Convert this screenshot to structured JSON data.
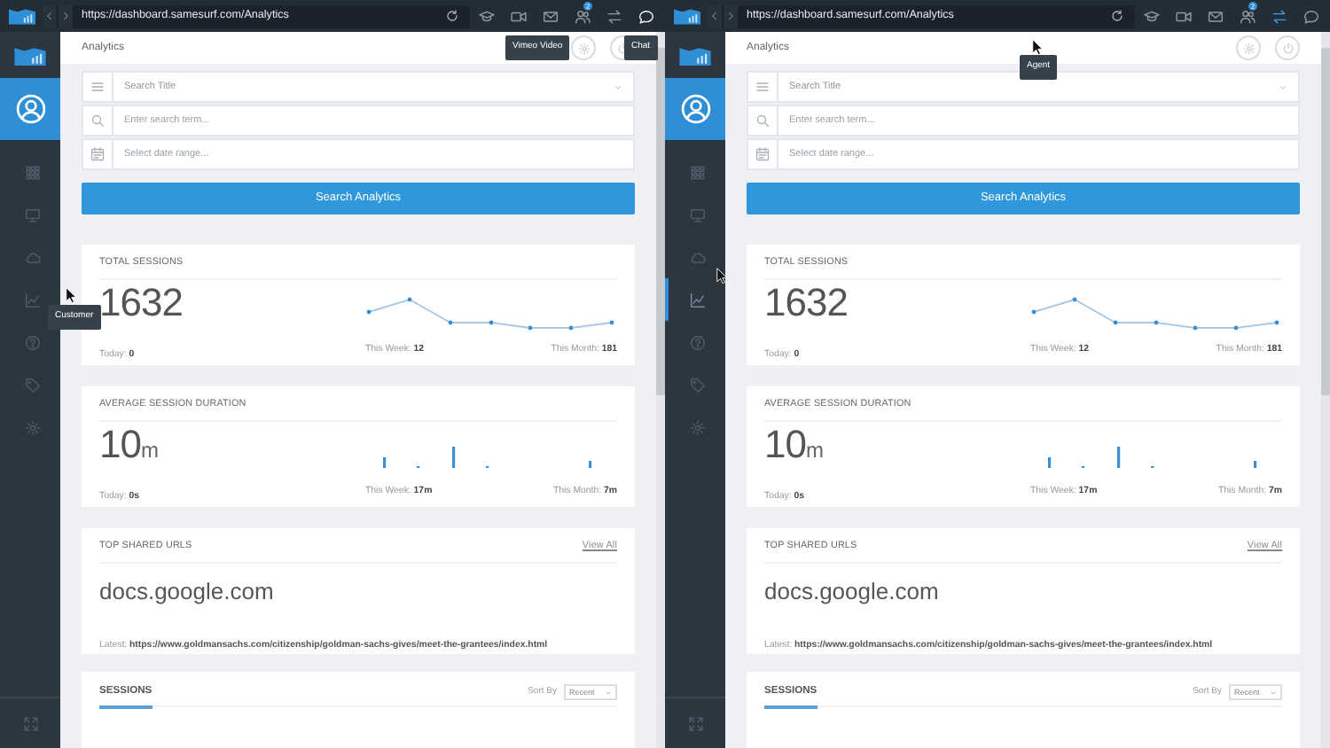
{
  "panes": [
    {
      "address": "https://dashboard.samesurf.com/Analytics",
      "toolbar": [
        {
          "kind": "cap",
          "active": false
        },
        {
          "kind": "video",
          "active": false
        },
        {
          "kind": "mail",
          "active": false
        },
        {
          "kind": "users",
          "active": false,
          "badge": "2"
        },
        {
          "kind": "transfer",
          "active": false
        },
        {
          "kind": "chat",
          "active": true
        }
      ],
      "sidebar": [
        {
          "kind": "grid",
          "selected": false
        },
        {
          "kind": "monitor",
          "selected": false
        },
        {
          "kind": "cloud",
          "selected": false
        },
        {
          "kind": "chart",
          "selected": false
        },
        {
          "kind": "help",
          "selected": false
        },
        {
          "kind": "tag",
          "selected": false
        },
        {
          "kind": "gear",
          "selected": false
        }
      ],
      "page_title": "Analytics",
      "search": {
        "title_placeholder": "Search Title",
        "term_placeholder": "Enter search term...",
        "date_placeholder": "Select date range...",
        "button": "Search Analytics"
      },
      "stats": [
        {
          "title": "TOTAL SESSIONS",
          "value": "1632",
          "kind": "line",
          "footer": [
            "Today: **0**",
            "This Week: **12**",
            "This Month: **181**"
          ]
        },
        {
          "title": "AVERAGE SESSION DURATION",
          "value": "10",
          "unit": "m",
          "kind": "bars",
          "footer": [
            "Today: **0s**",
            "This Week: **17m**",
            "This Month: **7m**"
          ]
        }
      ],
      "urls": {
        "title": "TOP SHARED URLS",
        "link": "View All",
        "domain": "docs.google.com",
        "latest": "Latest: **https://www.goldmansachs.com/citizenship/goldman-sachs-gives/meet-the-grantees/index.html**"
      },
      "sessions": {
        "tab": "SESSIONS",
        "sort_label": "Sort By",
        "sort_value": "Recent"
      },
      "tooltips": [
        {
          "text": "Vimeo Video",
          "kind": "video"
        },
        {
          "text": "Chat",
          "kind": "chat"
        },
        {
          "text": "Customer",
          "kind": "sidebar"
        }
      ],
      "pointers": [
        {
          "kind": "edge"
        }
      ]
    },
    {
      "address": "https://dashboard.samesurf.com/Analytics",
      "toolbar": [
        {
          "kind": "cap",
          "active": false
        },
        {
          "kind": "video",
          "active": false
        },
        {
          "kind": "mail",
          "active": false
        },
        {
          "kind": "users",
          "active": false,
          "badge": "2"
        },
        {
          "kind": "transfer",
          "active": true
        },
        {
          "kind": "chat",
          "active": false
        }
      ],
      "sidebar": [
        {
          "kind": "grid",
          "selected": false
        },
        {
          "kind": "monitor",
          "selected": false
        },
        {
          "kind": "cloud",
          "selected": false
        },
        {
          "kind": "chart",
          "selected": true
        },
        {
          "kind": "help",
          "selected": false
        },
        {
          "kind": "tag",
          "selected": false
        },
        {
          "kind": "gear",
          "selected": false
        }
      ],
      "page_title": "Analytics",
      "search": {
        "title_placeholder": "Search Title",
        "term_placeholder": "Enter search term...",
        "date_placeholder": "Select date range...",
        "button": "Search Analytics"
      },
      "stats": [
        {
          "title": "TOTAL SESSIONS",
          "value": "1632",
          "kind": "line",
          "footer": [
            "Today: **0**",
            "This Week: **12**",
            "This Month: **181**"
          ]
        },
        {
          "title": "AVERAGE SESSION DURATION",
          "value": "10",
          "unit": "m",
          "kind": "bars",
          "footer": [
            "Today: **0s**",
            "This Week: **17m**",
            "This Month: **7m**"
          ]
        }
      ],
      "urls": {
        "title": "TOP SHARED URLS",
        "link": "View All",
        "domain": "docs.google.com",
        "latest": "Latest: **https://www.goldmansachs.com/citizenship/goldman-sachs-gives/meet-the-grantees/index.html**"
      },
      "sessions": {
        "tab": "SESSIONS",
        "sort_label": "Sort By",
        "sort_value": "Recent"
      },
      "tooltips": [
        {
          "text": "Agent",
          "kind": "header"
        }
      ],
      "pointers": [
        {
          "kind": "header"
        },
        {
          "kind": "sidebar"
        }
      ]
    }
  ]
}
